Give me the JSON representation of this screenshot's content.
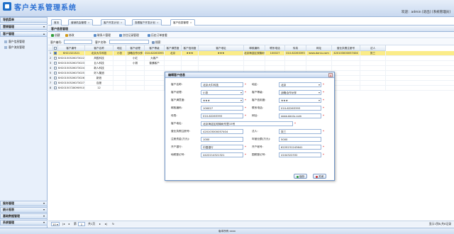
{
  "header": {
    "title": "客户关系管理系统",
    "welcome": "欢迎：admin [退出] [系统管理员]"
  },
  "sidebar": {
    "title": "导航菜单",
    "groups": [
      {
        "label": "营销管理",
        "active": false
      },
      {
        "label": "客户管理",
        "active": true
      }
    ],
    "items": [
      "客户信息管理",
      "客户流失管理"
    ],
    "bottom_groups": [
      "服务管理",
      "统计报表",
      "基础数据管理",
      "系统管理"
    ]
  },
  "tabs": [
    {
      "label": "首页"
    },
    {
      "label": "营销机会管理"
    },
    {
      "label": "客户开发计划"
    },
    {
      "label": "查看客户开发计划"
    },
    {
      "label": "客户信息管理",
      "active": true
    }
  ],
  "panel": {
    "title": "客户信息管理"
  },
  "toolbar": [
    {
      "label": "创建",
      "color": "#2f9c3a"
    },
    {
      "label": "修改",
      "color": "#d19a1a"
    },
    {
      "label": "联系人管理",
      "color": "#5a8cc8"
    },
    {
      "label": "交往记录管理",
      "color": "#5a8cc8"
    },
    {
      "label": "历史订单查看",
      "color": "#5a8cc8"
    }
  ],
  "search": {
    "code_label": "客户编号:",
    "name_label": "客户名称:",
    "button": "搜索"
  },
  "grid": {
    "columns": [
      "客户编号",
      "客户名称",
      "地区",
      "客户经理",
      "客户等级",
      "客户满意度",
      "客户信用度",
      "客户地址",
      "邮政编码",
      "联系电话",
      "传真",
      "网址",
      "营业执照注册号",
      "法人"
    ],
    "rows": [
      {
        "no": "1",
        "checked": true,
        "cells": [
          "KH21321321",
          "北京大牛科技",
          "小张",
          "战略合作伙伴",
          "010-62263393",
          "北京",
          "★★★",
          "★★★",
          "北京海淀区双榆树东里15号",
          "100027",
          "010-62263393",
          "www.daniu.com",
          "420103000057404",
          "张三"
        ]
      },
      {
        "no": "2",
        "checked": false,
        "cells": [
          "KH20150526073022",
          "风胜科技",
          "",
          "小红",
          "大客户",
          "",
          "",
          "",
          "",
          "",
          "",
          "",
          "",
          ""
        ]
      },
      {
        "no": "3",
        "checked": false,
        "cells": [
          "KH20150526073023",
          "巨人科技",
          "",
          "小丽",
          "普通客户",
          "",
          "",
          "",
          "",
          "",
          "",
          "",
          "",
          ""
        ]
      },
      {
        "no": "4",
        "checked": false,
        "cells": [
          "KH20150526073024",
          "新人科技",
          "",
          "",
          "",
          "",
          "",
          "",
          "",
          "",
          "",
          "",
          "",
          ""
        ]
      },
      {
        "no": "5",
        "checked": false,
        "cells": [
          "KH20150526073025",
          "好人集团",
          "",
          "",
          "",
          "",
          "",
          "",
          "",
          "",
          "",
          "",
          "",
          ""
        ]
      },
      {
        "no": "6",
        "checked": false,
        "cells": [
          "KH20150526073026",
          "新浪",
          "",
          "",
          "",
          "",
          "",
          "",
          "",
          "",
          "",
          "",
          "",
          ""
        ]
      },
      {
        "no": "7",
        "checked": false,
        "cells": [
          "KH20150526073027",
          "百度",
          "",
          "",
          "",
          "",
          "",
          "",
          "",
          "",
          "",
          "",
          "",
          ""
        ]
      },
      {
        "no": "8",
        "checked": false,
        "cells": [
          "KH20150728090910",
          "12",
          "",
          "",
          "",
          "",
          "",
          "",
          "42",
          "52",
          "112",
          "722",
          "",
          ""
        ]
      }
    ]
  },
  "pager": {
    "page_size": "10",
    "page_label": "第",
    "page": "1",
    "total_label": "共1页",
    "summary": "显示1到8,共8记录"
  },
  "footer": {
    "text": "版本所有 xxxx"
  },
  "dialog": {
    "title": "编辑客户信息",
    "fields": [
      {
        "label": "客户名称:",
        "value": "北京大牛科技",
        "required": true
      },
      {
        "label": "地区:",
        "value": "北京",
        "select": true,
        "required": true
      },
      {
        "label": "客户经理:",
        "value": "小张",
        "select": true,
        "required": true
      },
      {
        "label": "客户等级:",
        "value": "战略合作伙伴",
        "select": true,
        "required": true
      },
      {
        "label": "客户满意度:",
        "value": "★★★",
        "select": true,
        "required": true
      },
      {
        "label": "客户信用度:",
        "value": "★★★",
        "select": true,
        "required": true
      },
      {
        "label": "邮政编码:",
        "value": "100027",
        "required": true
      },
      {
        "label": "联系电话:",
        "value": "010-62263393",
        "required": true
      },
      {
        "label": "传真:",
        "value": "010-62263393",
        "required": true
      },
      {
        "label": "网址:",
        "value": "www.daniu.com",
        "required": true
      },
      {
        "label": "客户地址:",
        "value": "北京海淀区双榆树东里15号",
        "required": true,
        "wide": true
      },
      {
        "label": "营业执照注册号:",
        "value": "420103000057404"
      },
      {
        "label": "法人:",
        "value": "张三",
        "required": true
      },
      {
        "label": "注册资金(万元):",
        "value": "1000"
      },
      {
        "label": "年营业额(万元):",
        "value": "5000"
      },
      {
        "label": "开户银行:",
        "value": "中国银行",
        "required": true
      },
      {
        "label": "开户帐号:",
        "value": "6225231243641",
        "required": true
      },
      {
        "label": "地税登记号:",
        "value": "4422214321321",
        "required": true
      },
      {
        "label": "国税登记号:",
        "value": "4104322332",
        "required": true
      }
    ],
    "save": "保存",
    "close": "关闭"
  }
}
